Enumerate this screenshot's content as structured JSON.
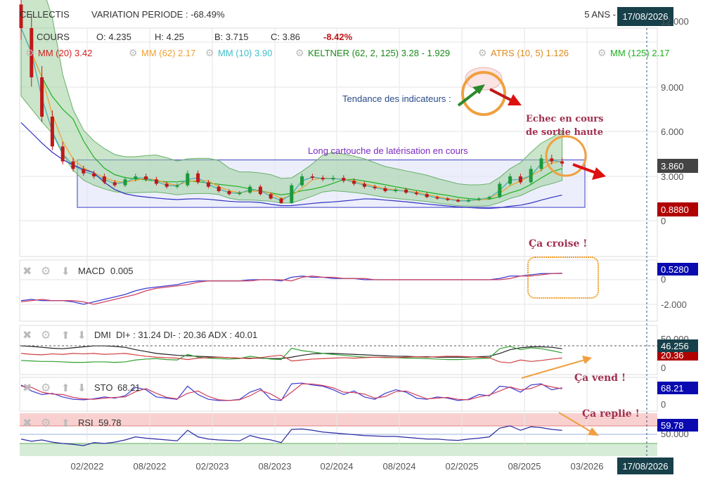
{
  "header": {
    "symbol": "CELLECTIS",
    "variation": "VARIATION PERIODE : -68.49%",
    "period": "5 ANS -",
    "date_badge": "17/08/2026"
  },
  "ohlc": {
    "label": "COURS",
    "open": "O: 4.235",
    "high": "H: 4.25",
    "low": "B: 3.715",
    "close": "C: 3.86",
    "change": "-8.42%"
  },
  "legend": [
    {
      "label": "MM (20) 3.42",
      "color": "#d62020"
    },
    {
      "label": "MM (62) 2.17",
      "color": "#f0a030"
    },
    {
      "label": "MM (10) 3.90",
      "color": "#40c0c8"
    },
    {
      "label": "KELTNER (62, 2, 125) 3.28 - 1.929",
      "color": "#1a8a1a"
    },
    {
      "label": "ATRS (10, 5) 1.126",
      "color": "#e08a20"
    },
    {
      "label": "MM (125) 2.17",
      "color": "#20b020"
    }
  ],
  "annotations": {
    "trend": "Tendance des indicateurs :",
    "box": "Long cartouche de latérisation en cours",
    "fail_line1": "Echec en cours",
    "fail_line2": "de sortie haute",
    "cross": "Ça croise !",
    "sell": "Ça vend !",
    "fold": "Ça replie !"
  },
  "axis": {
    "price_ticks": [
      "12.000",
      "9.000",
      "6.000",
      "3.000",
      "0"
    ],
    "price_badge": "3.860",
    "low_badge": "0.8880",
    "macd_ticks": [
      "0",
      "-2.000"
    ],
    "macd_badge": "0.5280",
    "dmi_tick_top": "50.000",
    "dmi_zero": "0",
    "dmi_badge": "46.256",
    "dmi_badge2": "20.36",
    "sto_zero": "0",
    "sto_badge": "68.21",
    "rsi_tick": "50.000",
    "rsi_badge": "59.78",
    "dates": [
      "02/2022",
      "08/2022",
      "02/2023",
      "08/2023",
      "02/2024",
      "08/2024",
      "02/2025",
      "08/2025",
      "03/2026"
    ],
    "cursor_date": "17/08/2026"
  },
  "panels": {
    "macd": "MACD",
    "macd_val": "0.005",
    "dmi": "DMI",
    "dmi_val": "DI+ : 31.24 DI- : 20.36 ADX : 40.01",
    "sto": "STO",
    "sto_val": "68.21",
    "rsi": "RSI",
    "rsi_val": "59.78"
  },
  "colors": {
    "up": "#1a9a3a",
    "down": "#c01818",
    "grid": "#e4e4e4",
    "badge_blue": "#0a0ab0",
    "badge_dark": "#17404a",
    "badge_red": "#b00000"
  },
  "chart_data": {
    "type": "line",
    "title": "CELLECTIS 5 ANS",
    "x_start": "08/2021",
    "x_step": "month",
    "price_box_range": [
      0.9,
      4.1
    ],
    "price": [
      12,
      9.5,
      7,
      5,
      4,
      3.5,
      3.2,
      3.0,
      2.6,
      2.4,
      2.8,
      3.0,
      2.8,
      2.5,
      2.3,
      2.4,
      3.2,
      2.6,
      2.3,
      2.0,
      1.8,
      1.9,
      2.3,
      1.8,
      1.5,
      1.2,
      2.4,
      3.0,
      2.9,
      2.8,
      2.9,
      2.7,
      2.5,
      2.3,
      2.2,
      2.0,
      2.1,
      1.9,
      1.8,
      1.6,
      1.5,
      1.4,
      1.3,
      1.4,
      1.5,
      1.6,
      2.5,
      3.0,
      2.6,
      3.5,
      4.2,
      4.0,
      3.86
    ],
    "macd": [
      -1.7,
      -1.6,
      -1.7,
      -1.7,
      -1.7,
      -1.8,
      -2.0,
      -1.8,
      -1.6,
      -1.4,
      -1.2,
      -0.9,
      -0.7,
      -0.6,
      -0.5,
      -0.4,
      -0.2,
      -0.1,
      -0.1,
      -0.1,
      -0.1,
      -0.1,
      0,
      0,
      0,
      -0.1,
      0.2,
      0.3,
      0.2,
      0.2,
      0.1,
      0.1,
      0.1,
      0,
      0,
      0,
      0,
      0,
      0,
      0,
      0,
      0,
      0,
      0,
      0,
      0,
      0.1,
      0.3,
      0.3,
      0.4,
      0.5,
      0.5,
      0.53
    ],
    "macd_signal": [
      -1.8,
      -1.7,
      -1.6,
      -1.7,
      -1.7,
      -1.7,
      -1.8,
      -2.0,
      -1.8,
      -1.6,
      -1.4,
      -1.2,
      -0.9,
      -0.7,
      -0.6,
      -0.5,
      -0.4,
      -0.2,
      -0.1,
      -0.1,
      -0.1,
      -0.1,
      -0.1,
      0,
      0,
      0,
      -0.1,
      0.2,
      0.3,
      0.2,
      0.2,
      0.1,
      0.1,
      0.1,
      0,
      0,
      0,
      0,
      0,
      0,
      0,
      0,
      0,
      0,
      0,
      0,
      0,
      0.1,
      0.3,
      0.3,
      0.4,
      0.5,
      0.5
    ],
    "adx": [
      46,
      45,
      43,
      41,
      40,
      42,
      44,
      46,
      46,
      45,
      43,
      38,
      34,
      30,
      28,
      26,
      25,
      24,
      23,
      22,
      21,
      20,
      20,
      20,
      19,
      19,
      22,
      26,
      29,
      30,
      30,
      29,
      28,
      27,
      26,
      25,
      24,
      24,
      23,
      23,
      22,
      22,
      22,
      22,
      23,
      24,
      30,
      38,
      42,
      44,
      44,
      43,
      40.01
    ],
    "di_plus": [
      15,
      14,
      13,
      13,
      12,
      11,
      11,
      12,
      12,
      11,
      12,
      16,
      18,
      19,
      17,
      16,
      28,
      22,
      20,
      19,
      18,
      19,
      24,
      21,
      18,
      17,
      41,
      36,
      33,
      30,
      28,
      26,
      24,
      22,
      22,
      21,
      21,
      20,
      20,
      19,
      18,
      17,
      17,
      18,
      19,
      20,
      40,
      45,
      38,
      42,
      40,
      36,
      31.24
    ],
    "di_minus": [
      30,
      28,
      27,
      29,
      28,
      30,
      29,
      30,
      28,
      29,
      30,
      27,
      24,
      22,
      21,
      20,
      17,
      20,
      21,
      22,
      21,
      20,
      19,
      21,
      24,
      26,
      14,
      16,
      18,
      19,
      20,
      21,
      20,
      21,
      22,
      22,
      21,
      22,
      23,
      22,
      23,
      24,
      24,
      23,
      22,
      21,
      12,
      10,
      16,
      13,
      15,
      18,
      20.36
    ],
    "sto_k": [
      80,
      55,
      40,
      45,
      30,
      20,
      18,
      22,
      30,
      25,
      35,
      70,
      60,
      30,
      25,
      20,
      75,
      40,
      20,
      15,
      15,
      20,
      50,
      65,
      20,
      15,
      85,
      88,
      80,
      75,
      60,
      40,
      55,
      30,
      20,
      45,
      60,
      50,
      25,
      20,
      30,
      25,
      15,
      20,
      40,
      35,
      75,
      70,
      50,
      80,
      85,
      60,
      68.21
    ],
    "sto_d": [
      75,
      70,
      50,
      42,
      40,
      28,
      22,
      20,
      25,
      28,
      30,
      52,
      65,
      45,
      28,
      22,
      45,
      55,
      32,
      18,
      15,
      18,
      35,
      58,
      42,
      18,
      50,
      85,
      84,
      78,
      68,
      50,
      48,
      42,
      25,
      32,
      52,
      55,
      38,
      22,
      25,
      28,
      20,
      18,
      30,
      38,
      55,
      72,
      60,
      65,
      82,
      72,
      64
    ],
    "rsi": [
      40,
      35,
      38,
      33,
      30,
      28,
      25,
      32,
      30,
      33,
      38,
      45,
      42,
      40,
      38,
      36,
      60,
      45,
      40,
      38,
      37,
      36,
      48,
      42,
      38,
      32,
      62,
      63,
      60,
      56,
      54,
      52,
      50,
      48,
      47,
      46,
      46,
      44,
      42,
      40,
      40,
      38,
      37,
      40,
      42,
      45,
      65,
      70,
      60,
      68,
      66,
      62,
      59.78
    ]
  }
}
